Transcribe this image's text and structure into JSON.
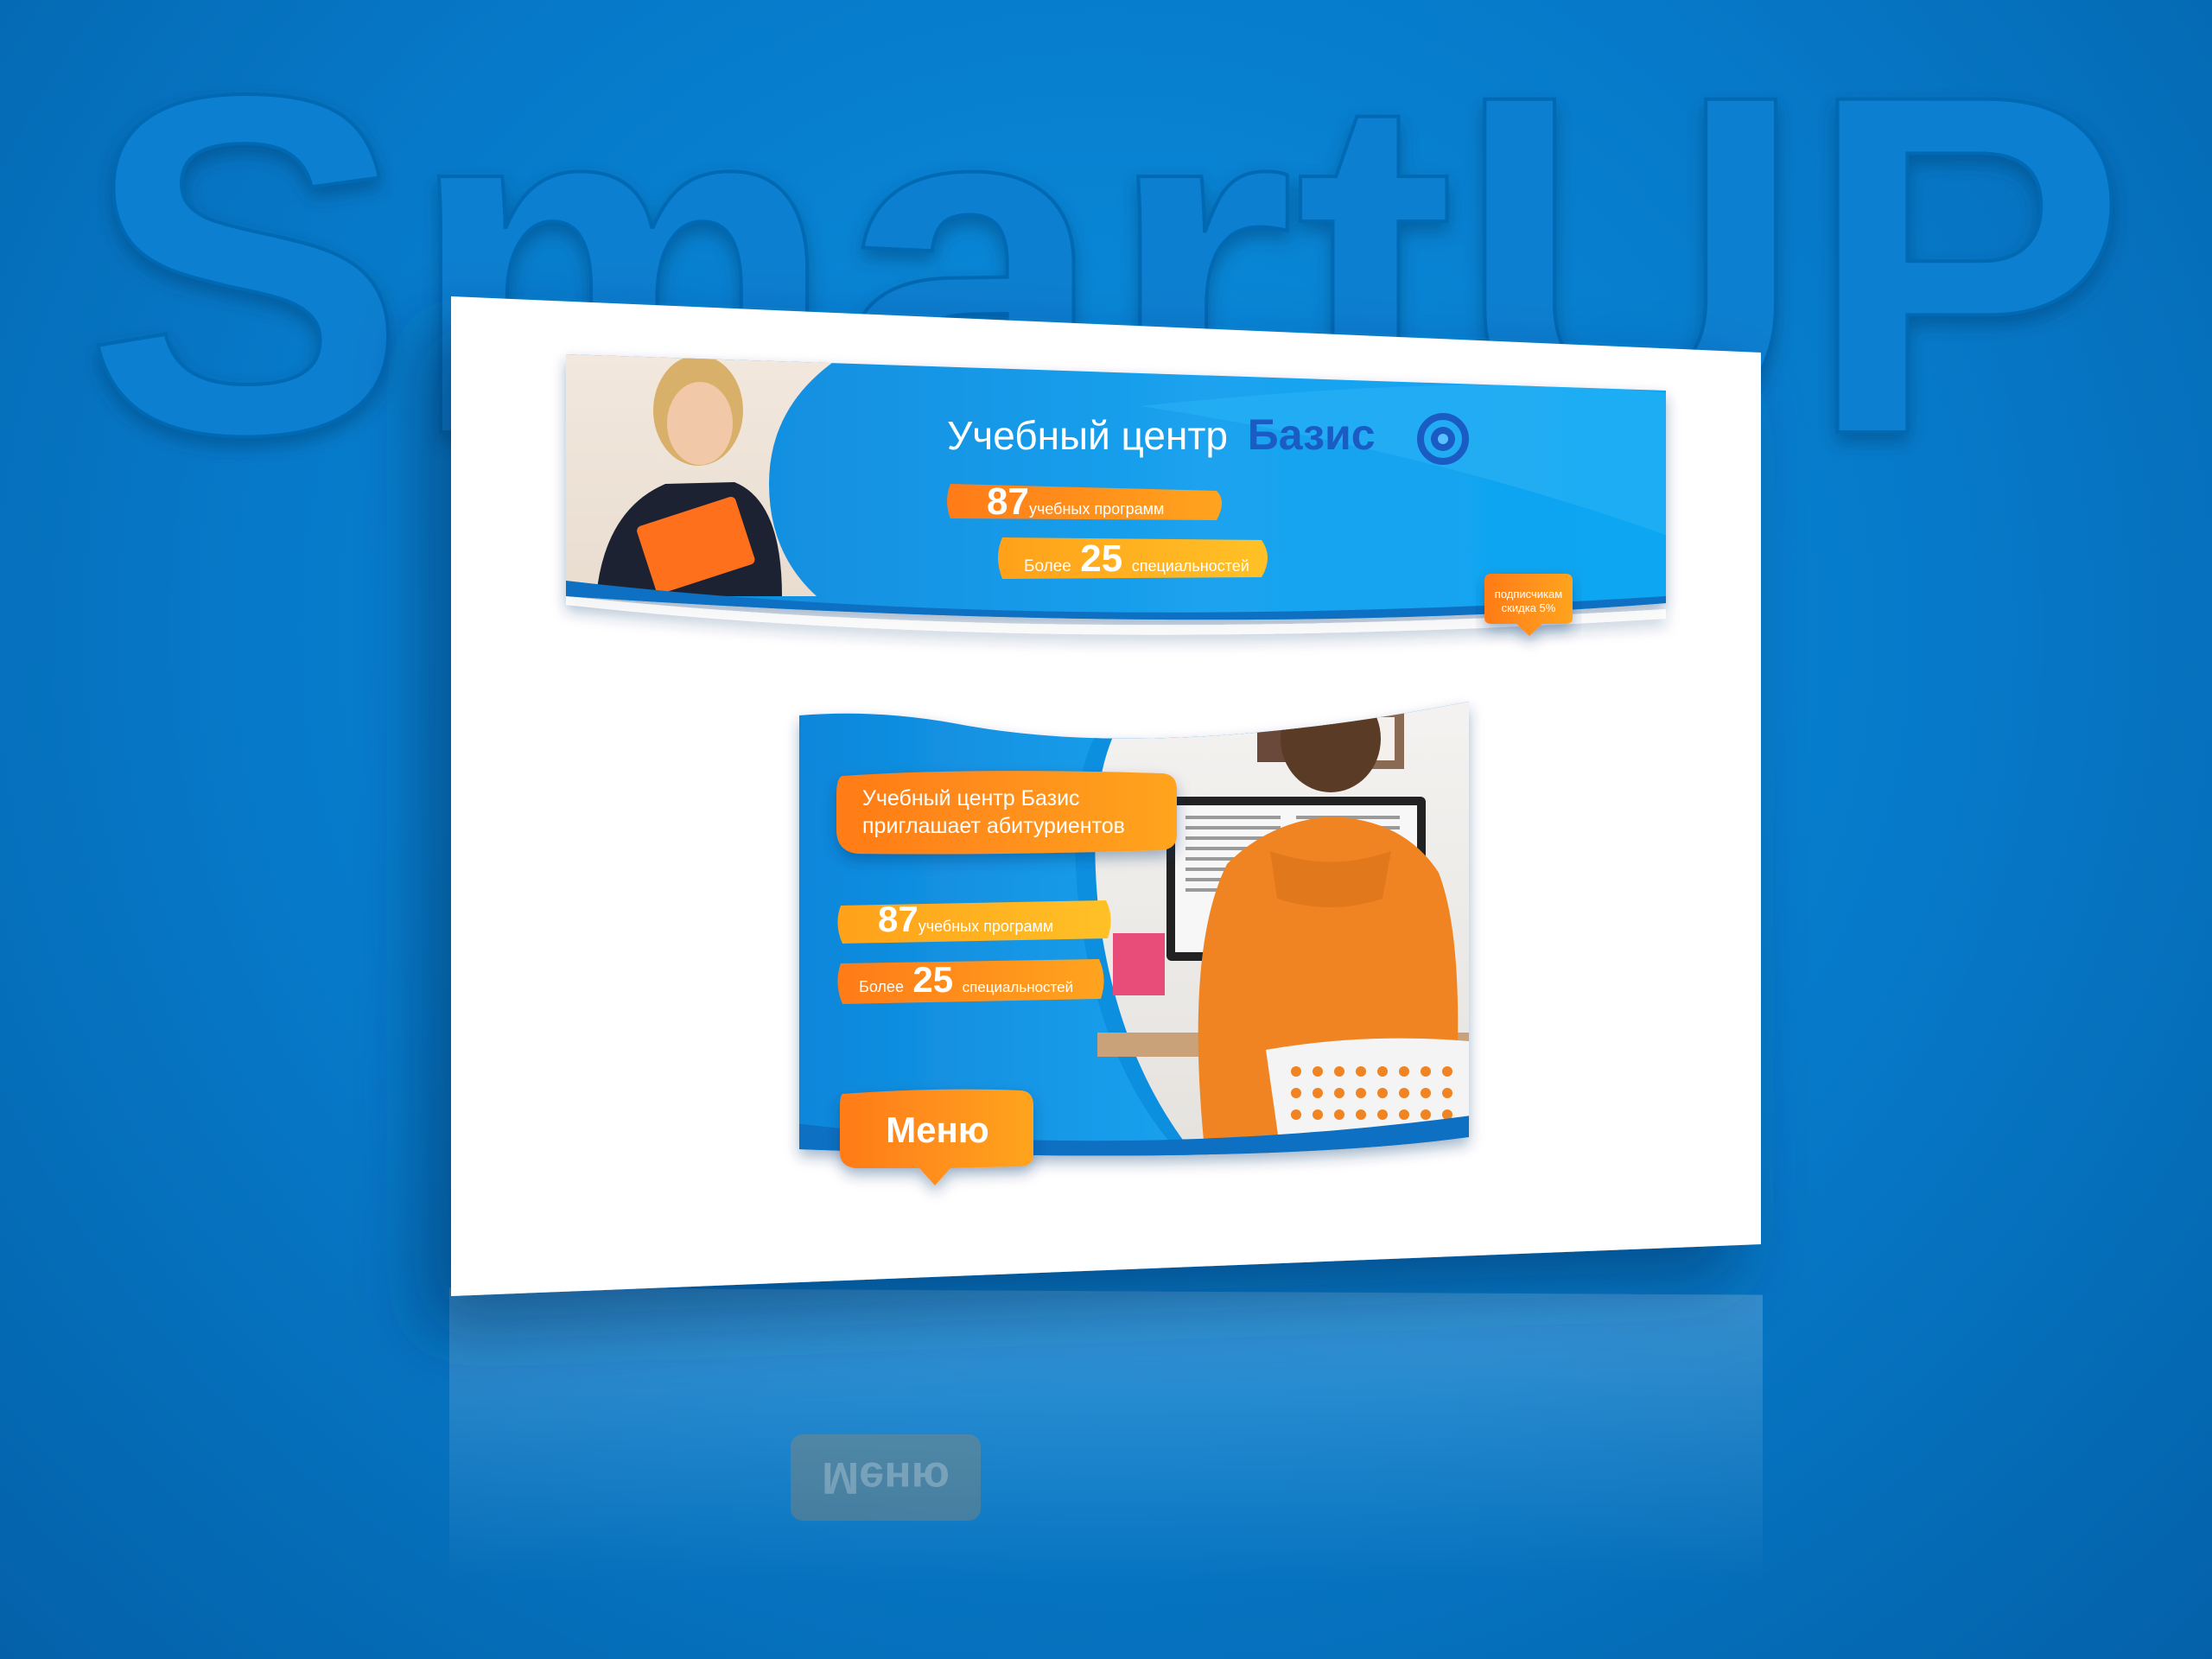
{
  "watermark": {
    "text": "SmartUP"
  },
  "banner1": {
    "title_prefix": "Учебный центр",
    "title_brand": "Базис",
    "stat1_number": "87",
    "stat1_text": "учебных программ",
    "stat2_prefix": "Более",
    "stat2_number": "25",
    "stat2_text": "специальностей",
    "badge_line1": "подписчикам",
    "badge_line2": "скидка 5%"
  },
  "banner2": {
    "headline_line1": "Учебный центр Базис",
    "headline_line2": "приглашает абитуриентов",
    "stat1_number": "87",
    "stat1_text": "учебных программ",
    "stat2_prefix": "Более",
    "stat2_number": "25",
    "stat2_text": "специальностей",
    "menu_label": "Меню"
  },
  "reflection": {
    "menu_label": "Меню"
  },
  "colors": {
    "brand_blue": "#0d8fe2",
    "accent_orange": "#ff8a1e",
    "accent_yellow": "#ffb21e"
  }
}
